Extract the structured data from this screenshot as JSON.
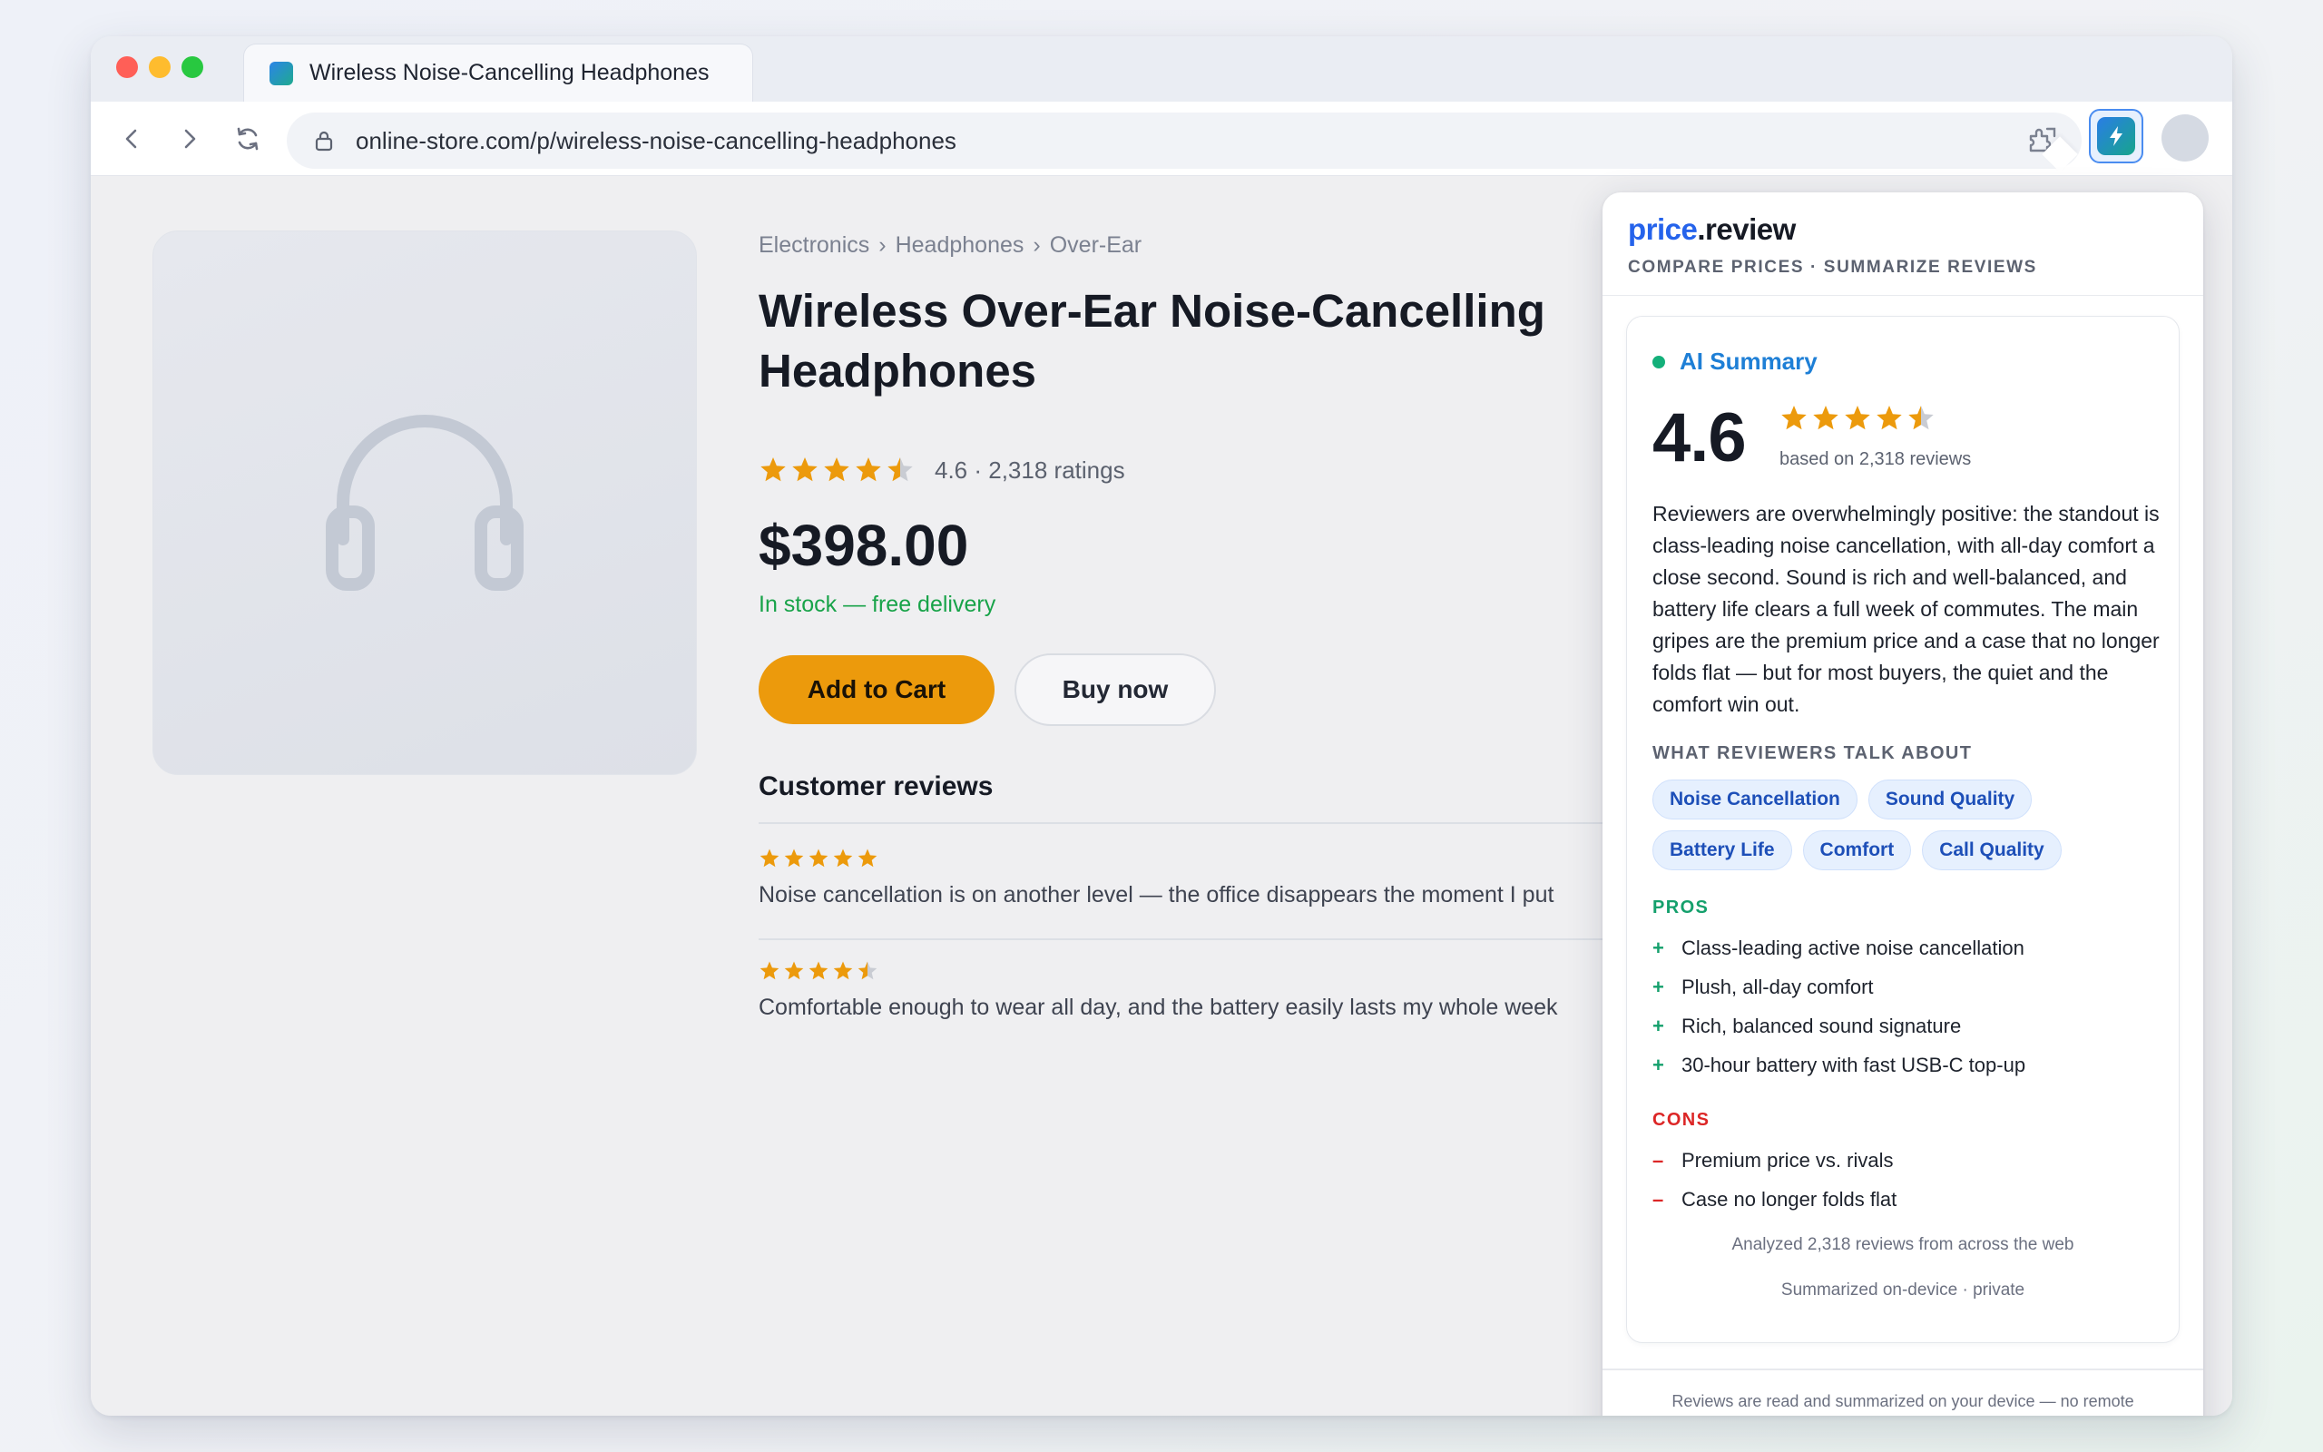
{
  "browser": {
    "tab_title": "Wireless Noise-Cancelling Headphones",
    "url": "online-store.com/p/wireless-noise-cancelling-headphones"
  },
  "product": {
    "breadcrumb": [
      "Electronics",
      "Headphones",
      "Over-Ear"
    ],
    "breadcrumb_sep": "›",
    "title": "Wireless Over-Ear Noise-Cancelling Headphones",
    "rating": 4.6,
    "rating_text": "4.6 · 2,318 ratings",
    "price": "$398.00",
    "stock": "In stock — free delivery",
    "add_to_cart": "Add to Cart",
    "buy_now": "Buy now"
  },
  "reviews": {
    "heading": "Customer reviews",
    "items": [
      {
        "rating": 5,
        "text": "Noise cancellation is on another level — the office disappears the moment I put"
      },
      {
        "rating": 4.5,
        "text": "Comfortable enough to wear all day, and the battery easily lasts my whole week"
      }
    ]
  },
  "extension": {
    "brand_a": "price",
    "brand_b": ".review",
    "tagline": "COMPARE PRICES · SUMMARIZE REVIEWS",
    "ai_label": "AI Summary",
    "score": "4.6",
    "score_rating": 4.6,
    "based_on": "based on 2,318 reviews",
    "summary": "Reviewers are overwhelmingly positive: the standout is class-leading noise cancellation, with all-day comfort a close second. Sound is rich and well-balanced, and battery life clears a full week of commutes. The main gripes are the premium price and a case that no longer folds flat — but for most buyers, the quiet and the comfort win out.",
    "topics_label": "WHAT REVIEWERS TALK ABOUT",
    "topics": [
      "Noise Cancellation",
      "Sound Quality",
      "Battery Life",
      "Comfort",
      "Call Quality"
    ],
    "pros_label": "PROS",
    "pros": [
      "Class-leading active noise cancellation",
      "Plush, all-day comfort",
      "Rich, balanced sound signature",
      "30-hour battery with fast USB-C top-up"
    ],
    "cons_label": "CONS",
    "cons": [
      "Premium price vs. rivals",
      "Case no longer folds flat"
    ],
    "pro_mark": "+",
    "con_mark": "–",
    "analyzed": "Analyzed 2,318 reviews from across the web",
    "privacy": "Summarized on-device · private",
    "footer": "Reviews are read and summarized on your device — no remote"
  },
  "colors": {
    "star": "#ec9a0c",
    "star_empty": "#c9ccd3",
    "accent": "#2563eb",
    "pros": "#14a06c",
    "cons": "#dc2626"
  }
}
